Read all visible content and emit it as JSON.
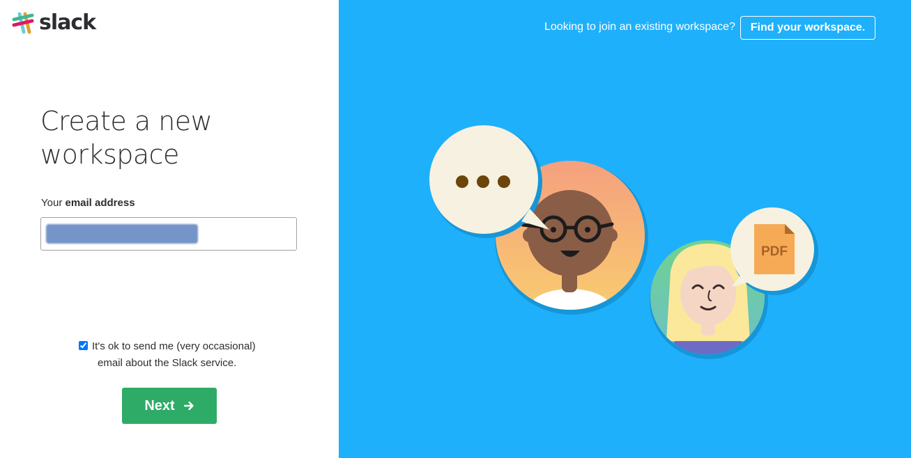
{
  "brand": {
    "name": "slack"
  },
  "form": {
    "title": "Create a new workspace",
    "email_label_prefix": "Your ",
    "email_label_bold": "email address",
    "email_value": "",
    "consent_line1": "It's ok to send me (very occasional)",
    "consent_line2": "email about the Slack service.",
    "consent_checked": true,
    "next_label": "Next"
  },
  "header": {
    "join_text": "Looking to join an existing workspace?",
    "find_workspace_label": "Find your workspace."
  },
  "illustration": {
    "file_badge": "PDF"
  },
  "colors": {
    "accent_green": "#2eab67",
    "panel_blue": "#1fb0fb"
  },
  "icons": [
    "slack-logo-icon",
    "arrow-right-icon",
    "chat-bubble-icon",
    "pdf-file-icon"
  ]
}
